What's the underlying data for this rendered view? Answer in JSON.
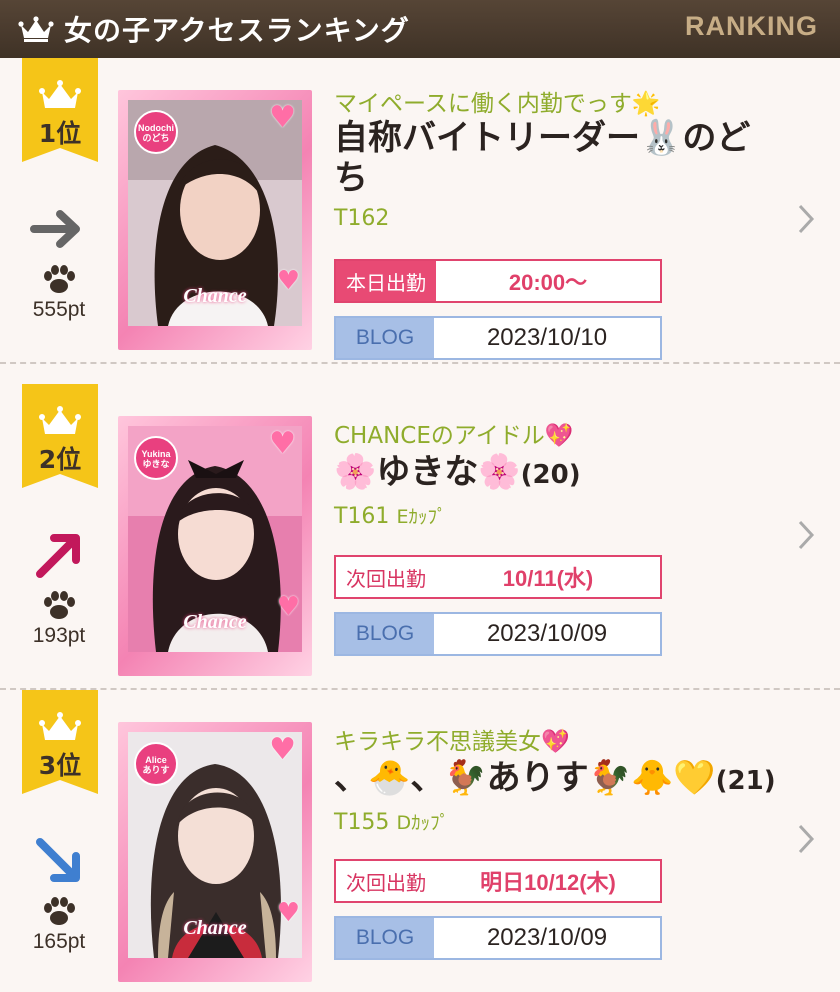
{
  "header": {
    "title": "女の子アクセスランキング",
    "right_label": "RANKING",
    "icon": "crown-icon"
  },
  "colors": {
    "header_bg": "#4a3b2e",
    "badge": "#f5c518",
    "catch": "#8fac2c",
    "work": "#e0446e",
    "blog": "#a7bfe6",
    "trend_up": "#c2185b",
    "trend_down": "#3f7fd0",
    "trend_flat": "#666666"
  },
  "rankings": [
    {
      "rank": "1位",
      "trend": "flat",
      "points": "555pt",
      "photo_name": "Nodochi",
      "photo_name_kana": "のどち",
      "photo_logo": "Chance",
      "catch": "マイペースに働く内勤でっす🌟",
      "name": "自称バイトリーダー🐰のどち",
      "age": "",
      "height": "T162",
      "cup": "",
      "work_label": "本日出勤",
      "work_value": "20:00〜",
      "blog_label": "BLOG",
      "blog_date": "2023/10/10"
    },
    {
      "rank": "2位",
      "trend": "up",
      "points": "193pt",
      "photo_name": "Yukina",
      "photo_name_kana": "ゆきな",
      "photo_logo": "Chance",
      "catch": "CHANCEのアイドル💖",
      "name": "🌸ゆきな🌸",
      "age": "(20)",
      "height": "T161",
      "cup": "Eｶｯﾌﾟ",
      "work_label": "次回出勤",
      "work_value": "10/11(水)",
      "blog_label": "BLOG",
      "blog_date": "2023/10/09"
    },
    {
      "rank": "3位",
      "trend": "down",
      "points": "165pt",
      "photo_name": "Alice",
      "photo_name_kana": "ありす",
      "photo_logo": "Chance",
      "catch": "キラキラ不思議美女💖",
      "name": "、🐣、🐓ありす🐓🐥💛",
      "age": "(21)",
      "height": "T155",
      "cup": "Dｶｯﾌﾟ",
      "work_label": "次回出勤",
      "work_value": "明日10/12(木)",
      "blog_label": "BLOG",
      "blog_date": "2023/10/09"
    }
  ]
}
